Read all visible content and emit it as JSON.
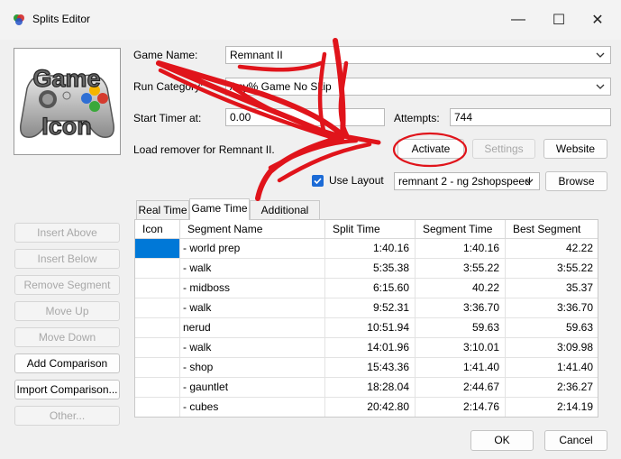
{
  "window": {
    "title": "Splits Editor",
    "min_glyph": "—",
    "max_glyph": "☐",
    "close_glyph": "✕"
  },
  "game_icon": {
    "lines": [
      "Game",
      "Icon"
    ]
  },
  "form": {
    "game_name_label": "Game Name:",
    "game_name_value": "Remnant II",
    "run_category_label": "Run Category:",
    "run_category_value": "Any% Game No Skip",
    "start_timer_label": "Start Timer at:",
    "start_timer_value": "0.00",
    "attempts_label": "Attempts:",
    "attempts_value": "744"
  },
  "autosplitter": {
    "description": "Load remover for Remnant II.",
    "activate_label": "Activate",
    "settings_label": "Settings",
    "website_label": "Website"
  },
  "layout": {
    "checkbox_label": "Use Layout",
    "checked": true,
    "layout_value": "remnant 2 - ng 2shopspeed",
    "browse_label": "Browse"
  },
  "left_buttons": {
    "insert_above": "Insert Above",
    "insert_below": "Insert Below",
    "remove_segment": "Remove Segment",
    "move_up": "Move Up",
    "move_down": "Move Down",
    "add_comparison": "Add Comparison",
    "import_comparison": "Import Comparison...",
    "other": "Other..."
  },
  "tabs": [
    {
      "label": "Real Time",
      "active": false
    },
    {
      "label": "Game Time",
      "active": true
    },
    {
      "label": "Additional Info",
      "active": false
    }
  ],
  "table": {
    "columns": [
      "Icon",
      "Segment Name",
      "Split Time",
      "Segment Time",
      "Best Segment"
    ],
    "rows": [
      {
        "name": "- world prep",
        "split": "1:40.16",
        "segment": "1:40.16",
        "best": "42.22"
      },
      {
        "name": "- walk",
        "split": "5:35.38",
        "segment": "3:55.22",
        "best": "3:55.22"
      },
      {
        "name": "- midboss",
        "split": "6:15.60",
        "segment": "40.22",
        "best": "35.37"
      },
      {
        "name": "- walk",
        "split": "9:52.31",
        "segment": "3:36.70",
        "best": "3:36.70"
      },
      {
        "name": "nerud",
        "split": "10:51.94",
        "segment": "59.63",
        "best": "59.63"
      },
      {
        "name": "- walk",
        "split": "14:01.96",
        "segment": "3:10.01",
        "best": "3:09.98"
      },
      {
        "name": "- shop",
        "split": "15:43.36",
        "segment": "1:41.40",
        "best": "1:41.40"
      },
      {
        "name": "- gauntlet",
        "split": "18:28.04",
        "segment": "2:44.67",
        "best": "2:36.27"
      },
      {
        "name": "- cubes",
        "split": "20:42.80",
        "segment": "2:14.76",
        "best": "2:14.19"
      }
    ]
  },
  "footer": {
    "ok_label": "OK",
    "cancel_label": "Cancel"
  },
  "colors": {
    "accent": "#0078d7",
    "checkbox": "#1c6bd6",
    "annotation": "#e0141b"
  }
}
